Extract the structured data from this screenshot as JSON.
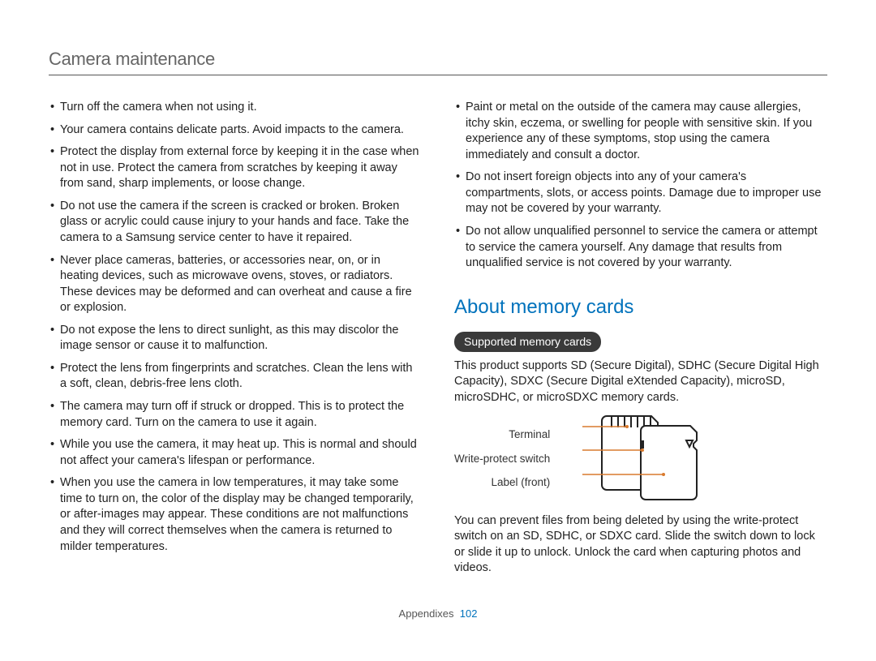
{
  "header": {
    "title": "Camera maintenance"
  },
  "left_bullets": [
    "Turn off the camera when not using it.",
    "Your camera contains delicate parts. Avoid impacts to the camera.",
    "Protect the display from external force by keeping it in the case when not in use. Protect the camera from scratches by keeping it away from sand, sharp implements, or loose change.",
    "Do not use the camera if the screen is cracked or broken. Broken glass or acrylic could cause injury to your hands and face. Take the camera to a Samsung service center to have it repaired.",
    "Never place cameras, batteries, or accessories near, on, or in heating devices, such as microwave ovens, stoves, or radiators. These devices may be deformed and can overheat and cause a fire or explosion.",
    "Do not expose the lens to direct sunlight, as this may discolor the image sensor or cause it to malfunction.",
    "Protect the lens from fingerprints and scratches. Clean the lens with a soft, clean, debris-free lens cloth.",
    "The camera may turn off if struck or dropped. This is to protect the memory card. Turn on the camera to use it again.",
    "While you use the camera, it may heat up. This is normal and should not affect your camera's lifespan or performance.",
    "When you use the camera in low temperatures, it may take some time to turn on, the color of the display may be changed temporarily, or after-images may appear. These conditions are not malfunctions and they will correct themselves when the camera is returned to milder temperatures."
  ],
  "right_bullets": [
    "Paint or metal on the outside of the camera may cause allergies, itchy skin, eczema, or swelling for people with sensitive skin. If you experience any of these symptoms, stop using the camera immediately and consult a doctor.",
    "Do not insert foreign objects into any of your camera's compartments, slots, or access points. Damage due to improper use may not be covered by your warranty.",
    "Do not allow unqualified personnel to service the camera or attempt to service the camera yourself. Any damage that results from unqualified service is not covered by your warranty."
  ],
  "section": {
    "title": "About memory cards",
    "pill": "Supported memory cards",
    "intro": "This product supports SD (Secure Digital), SDHC (Secure Digital High Capacity), SDXC (Secure Digital eXtended Capacity), microSD, microSDHC, or microSDXC memory cards.",
    "labels": {
      "terminal": "Terminal",
      "write_protect": "Write-protect switch",
      "label_front": "Label (front)"
    },
    "outro": "You can prevent files from being deleted by using the write-protect switch on an SD, SDHC, or SDXC card. Slide the switch down to lock or slide it up to unlock. Unlock the card when capturing photos and videos."
  },
  "footer": {
    "section": "Appendixes",
    "page": "102"
  }
}
